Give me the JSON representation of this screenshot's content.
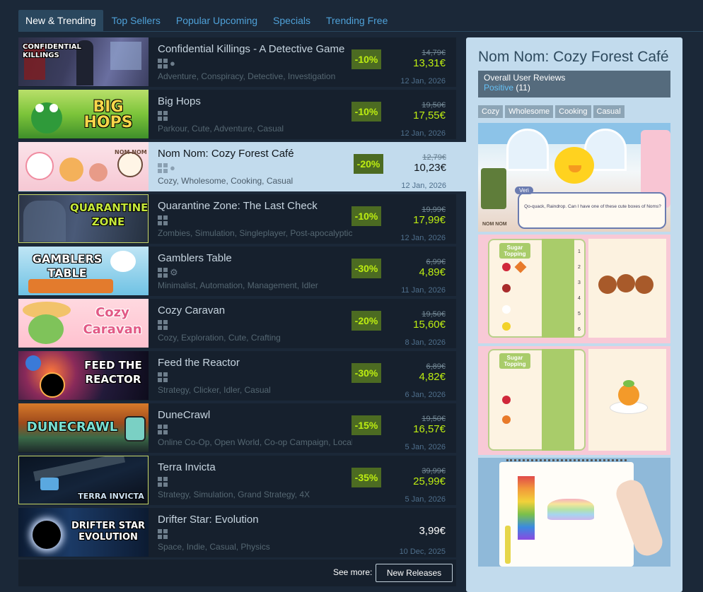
{
  "tabs": [
    {
      "label": "New & Trending",
      "active": true
    },
    {
      "label": "Top Sellers"
    },
    {
      "label": "Popular Upcoming"
    },
    {
      "label": "Specials"
    },
    {
      "label": "Trending Free"
    }
  ],
  "games": [
    {
      "name": "Confidential Killings - A Detective Game",
      "platforms": [
        "windows",
        "apple"
      ],
      "tags": "Adventure, Conspiracy, Detective, Investigation",
      "discount": "-10%",
      "original_price": "14,79€",
      "final_price": "13,31€",
      "date": "12 Jan, 2026",
      "capsule_text": "CONFIDENTIAL KILLINGS"
    },
    {
      "name": "Big Hops",
      "platforms": [
        "windows"
      ],
      "tags": "Parkour, Cute, Adventure, Casual",
      "discount": "-10%",
      "original_price": "19,50€",
      "final_price": "17,55€",
      "date": "12 Jan, 2026",
      "capsule_text": "BIG HOPS"
    },
    {
      "name": "Nom Nom: Cozy Forest Café",
      "platforms": [
        "windows",
        "apple"
      ],
      "tags": "Cozy, Wholesome, Cooking, Casual",
      "discount": "-20%",
      "original_price": "12,79€",
      "final_price": "10,23€",
      "date": "12 Jan, 2026",
      "capsule_text": "NOM NOM"
    },
    {
      "name": "Quarantine Zone: The Last Check",
      "platforms": [
        "windows"
      ],
      "tags": "Zombies, Simulation, Singleplayer, Post-apocalyptic",
      "discount": "-10%",
      "original_price": "19,99€",
      "final_price": "17,99€",
      "date": "12 Jan, 2026",
      "capsule_text": "QUARANTINE ZONE"
    },
    {
      "name": "Gamblers Table",
      "platforms": [
        "windows",
        "steam"
      ],
      "tags": "Minimalist, Automation, Management, Idler",
      "discount": "-30%",
      "original_price": "6,99€",
      "final_price": "4,89€",
      "date": "11 Jan, 2026",
      "capsule_text": "GAMBLERS TABLE"
    },
    {
      "name": "Cozy Caravan",
      "platforms": [
        "windows"
      ],
      "tags": "Cozy, Exploration, Cute, Crafting",
      "discount": "-20%",
      "original_price": "19,50€",
      "final_price": "15,60€",
      "date": "8 Jan, 2026",
      "capsule_text": "Cozy Caravan"
    },
    {
      "name": "Feed the Reactor",
      "platforms": [
        "windows"
      ],
      "tags": "Strategy, Clicker, Idler, Casual",
      "discount": "-30%",
      "original_price": "6,89€",
      "final_price": "4,82€",
      "date": "6 Jan, 2026",
      "capsule_text": "FEED THE REACTOR"
    },
    {
      "name": "DuneCrawl",
      "platforms": [
        "windows"
      ],
      "tags": "Online Co-Op, Open World, Co-op Campaign, Local",
      "discount": "-15%",
      "original_price": "19,50€",
      "final_price": "16,57€",
      "date": "5 Jan, 2026",
      "capsule_text": "DUNECRAWL"
    },
    {
      "name": "Terra Invicta",
      "platforms": [
        "windows"
      ],
      "tags": "Strategy, Simulation, Grand Strategy, 4X",
      "discount": "-35%",
      "original_price": "39,99€",
      "final_price": "25,99€",
      "date": "5 Jan, 2026",
      "capsule_text": "TERRA INVICTA"
    },
    {
      "name": "Drifter Star: Evolution",
      "platforms": [
        "windows"
      ],
      "tags": "Space, Indie, Casual, Physics",
      "discount": "",
      "original_price": "",
      "final_price": "3,99€",
      "date": "10 Dec, 2025",
      "capsule_text": "DRIFTER STAR EVOLUTION"
    }
  ],
  "see_more": {
    "label": "See more:",
    "button": "New Releases"
  },
  "detail": {
    "title": "Nom Nom: Cozy Forest Café",
    "reviews_label": "Overall User Reviews",
    "review_summary": "Positive",
    "review_count": "(11)",
    "tags": [
      "Cozy",
      "Wholesome",
      "Cooking",
      "Casual"
    ],
    "screenshots": [
      {
        "speaker": "Veri",
        "dialog": "Qo-quack, Raindrop. Can I have one of these cute boxes of Noms?",
        "logo": "NOM NOM"
      },
      {
        "label": "Sugar Topping",
        "numbers": [
          "1",
          "2",
          "3",
          "4",
          "5",
          "6"
        ]
      },
      {
        "label": "Sugar Topping"
      },
      {}
    ]
  },
  "colors": {
    "background": "#1b2838",
    "discount_bg": "#4c6b22",
    "discount_text": "#beee11",
    "link": "#4fa1d8",
    "highlight": "#c2dbed"
  }
}
